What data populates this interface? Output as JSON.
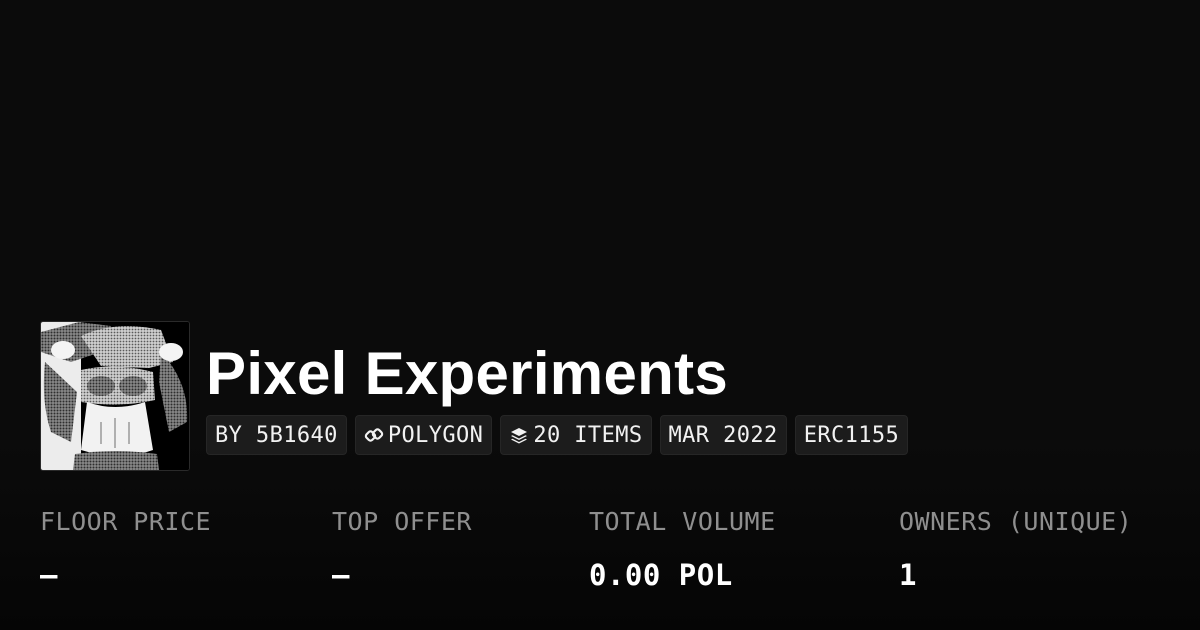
{
  "collection": {
    "title": "Pixel Experiments",
    "image_icon": "anime-figure-thumbnail"
  },
  "tags": [
    {
      "label": "BY 5B1640",
      "icon": null
    },
    {
      "label": "POLYGON",
      "icon": "chain-link-icon"
    },
    {
      "label": "20 ITEMS",
      "icon": "layers-icon"
    },
    {
      "label": "MAR 2022",
      "icon": null
    },
    {
      "label": "ERC1155",
      "icon": null
    }
  ],
  "stats": {
    "floor_price": {
      "label": "FLOOR PRICE",
      "value": "–"
    },
    "top_offer": {
      "label": "TOP OFFER",
      "value": "–"
    },
    "total_volume": {
      "label": "TOTAL VOLUME",
      "value": "0.00 POL"
    },
    "owners": {
      "label": "OWNERS (UNIQUE)",
      "value": "1"
    }
  },
  "colors": {
    "background": "#0b0b0b",
    "tag_background": "#1c1c1c",
    "label_gray": "#8f8f8f",
    "text": "#ffffff"
  }
}
